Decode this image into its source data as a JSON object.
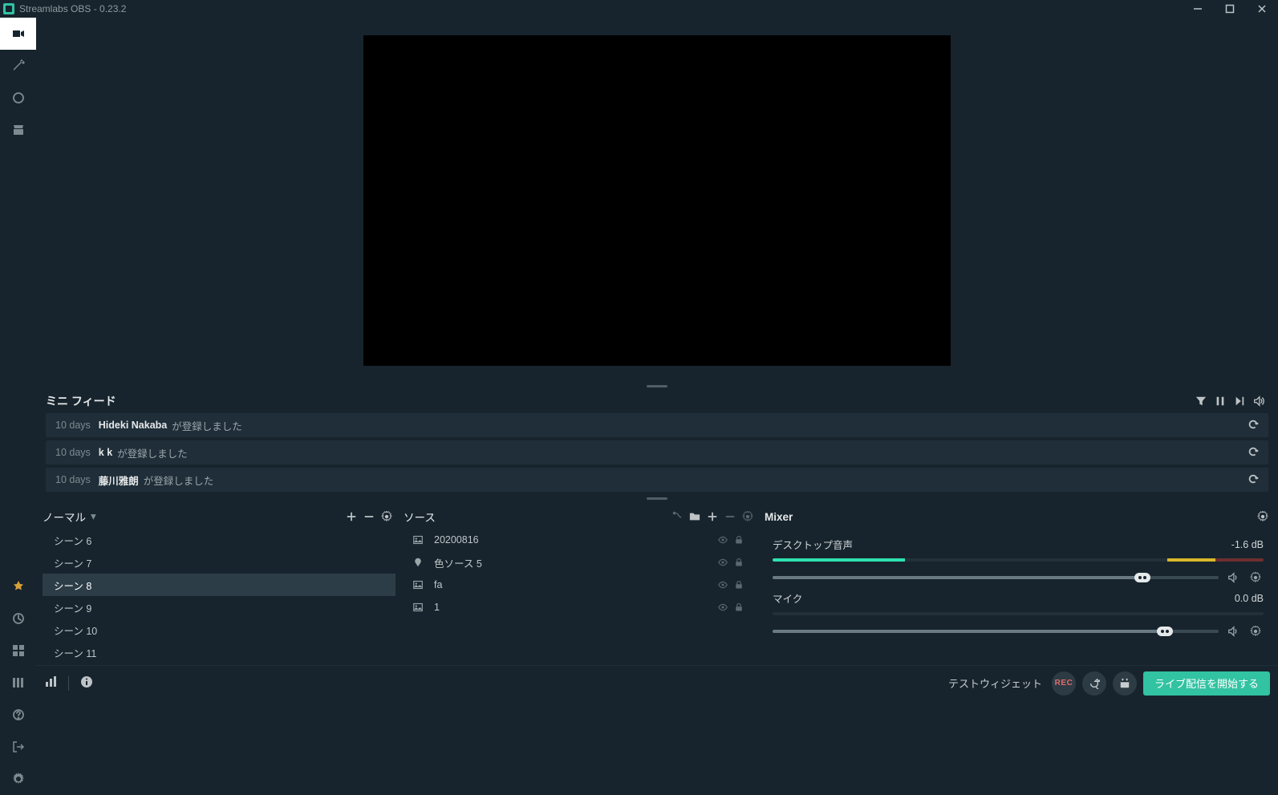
{
  "titlebar": {
    "title": "Streamlabs OBS - 0.23.2"
  },
  "feed": {
    "title": "ミニ フィード",
    "items": [
      {
        "age": "10 days",
        "user": "Hideki Nakaba",
        "msg": "が登録しました"
      },
      {
        "age": "10 days",
        "user": "k k",
        "msg": "が登録しました"
      },
      {
        "age": "10 days",
        "user": "藤川雅朗",
        "msg": "が登録しました"
      }
    ]
  },
  "scenes": {
    "mode": "ノーマル",
    "items": [
      {
        "label": "シーン 6",
        "active": false
      },
      {
        "label": "シーン 7",
        "active": false
      },
      {
        "label": "シーン 8",
        "active": true
      },
      {
        "label": "シーン 9",
        "active": false
      },
      {
        "label": "シーン 10",
        "active": false
      },
      {
        "label": "シーン 11",
        "active": false
      }
    ]
  },
  "sources": {
    "title": "ソース",
    "items": [
      {
        "type": "image",
        "name": "20200816"
      },
      {
        "type": "color",
        "name": "色ソース 5"
      },
      {
        "type": "image",
        "name": "fa"
      },
      {
        "type": "image",
        "name": "1"
      }
    ]
  },
  "mixer": {
    "title": "Mixer",
    "channels": [
      {
        "name": "デスクトップ音声",
        "db": "-1.6 dB",
        "level": 27,
        "slider": 83
      },
      {
        "name": "マイク",
        "db": "0.0 dB",
        "level": 0,
        "slider": 88
      }
    ]
  },
  "footer": {
    "label": "テストウィジェット",
    "rec": "REC",
    "go_live": "ライブ配信を開始する"
  }
}
